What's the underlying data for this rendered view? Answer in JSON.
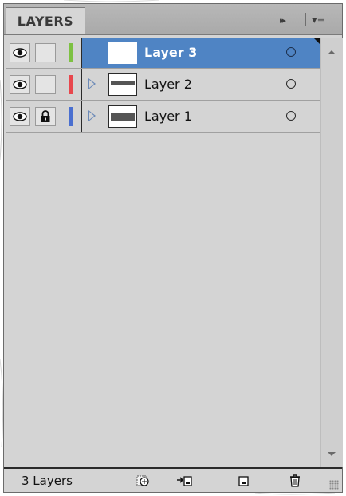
{
  "panel": {
    "tab_label": "LAYERS",
    "collapse_glyph": "▸▸",
    "menu_glyph": "▾≡"
  },
  "layers": [
    {
      "name": "Layer 3",
      "visible": true,
      "locked": false,
      "color": "#7dc142",
      "selected": true,
      "expandable": false
    },
    {
      "name": "Layer 2",
      "visible": true,
      "locked": false,
      "color": "#e8474d",
      "selected": false,
      "expandable": true
    },
    {
      "name": "Layer 1",
      "visible": true,
      "locked": true,
      "color": "#4a6fd0",
      "selected": false,
      "expandable": true
    }
  ],
  "footer": {
    "count_label": "3 Layers",
    "buttons": [
      "make-clipping-mask-icon",
      "create-sublayer-icon",
      "new-layer-icon",
      "delete-icon"
    ]
  },
  "colors": {
    "selection": "#4f84c4",
    "panel_bg": "#d4d4d4"
  }
}
